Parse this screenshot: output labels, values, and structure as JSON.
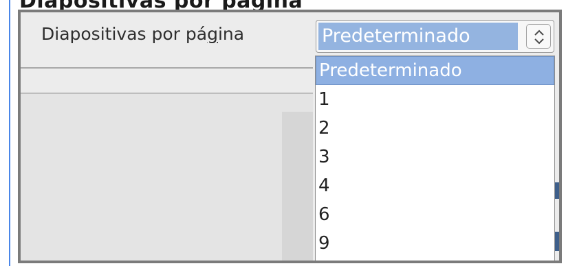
{
  "caption": {
    "text": "Diapositivas por página"
  },
  "dialog": {
    "label_before_mnemonic": "Diapositivas por pá",
    "label_mnemonic": "g",
    "label_after_mnemonic": "ina"
  },
  "combo": {
    "value": "Predeterminado",
    "spinner_icon": "up-down-chevron-icon"
  },
  "dropdown": {
    "options": [
      "Predeterminado",
      "1",
      "2",
      "3",
      "4",
      "6",
      "9"
    ],
    "selected_index": 0
  },
  "colors": {
    "accent": "#4a86e8",
    "selection": "#8eb0e2",
    "frame": "#7b7b7b"
  }
}
